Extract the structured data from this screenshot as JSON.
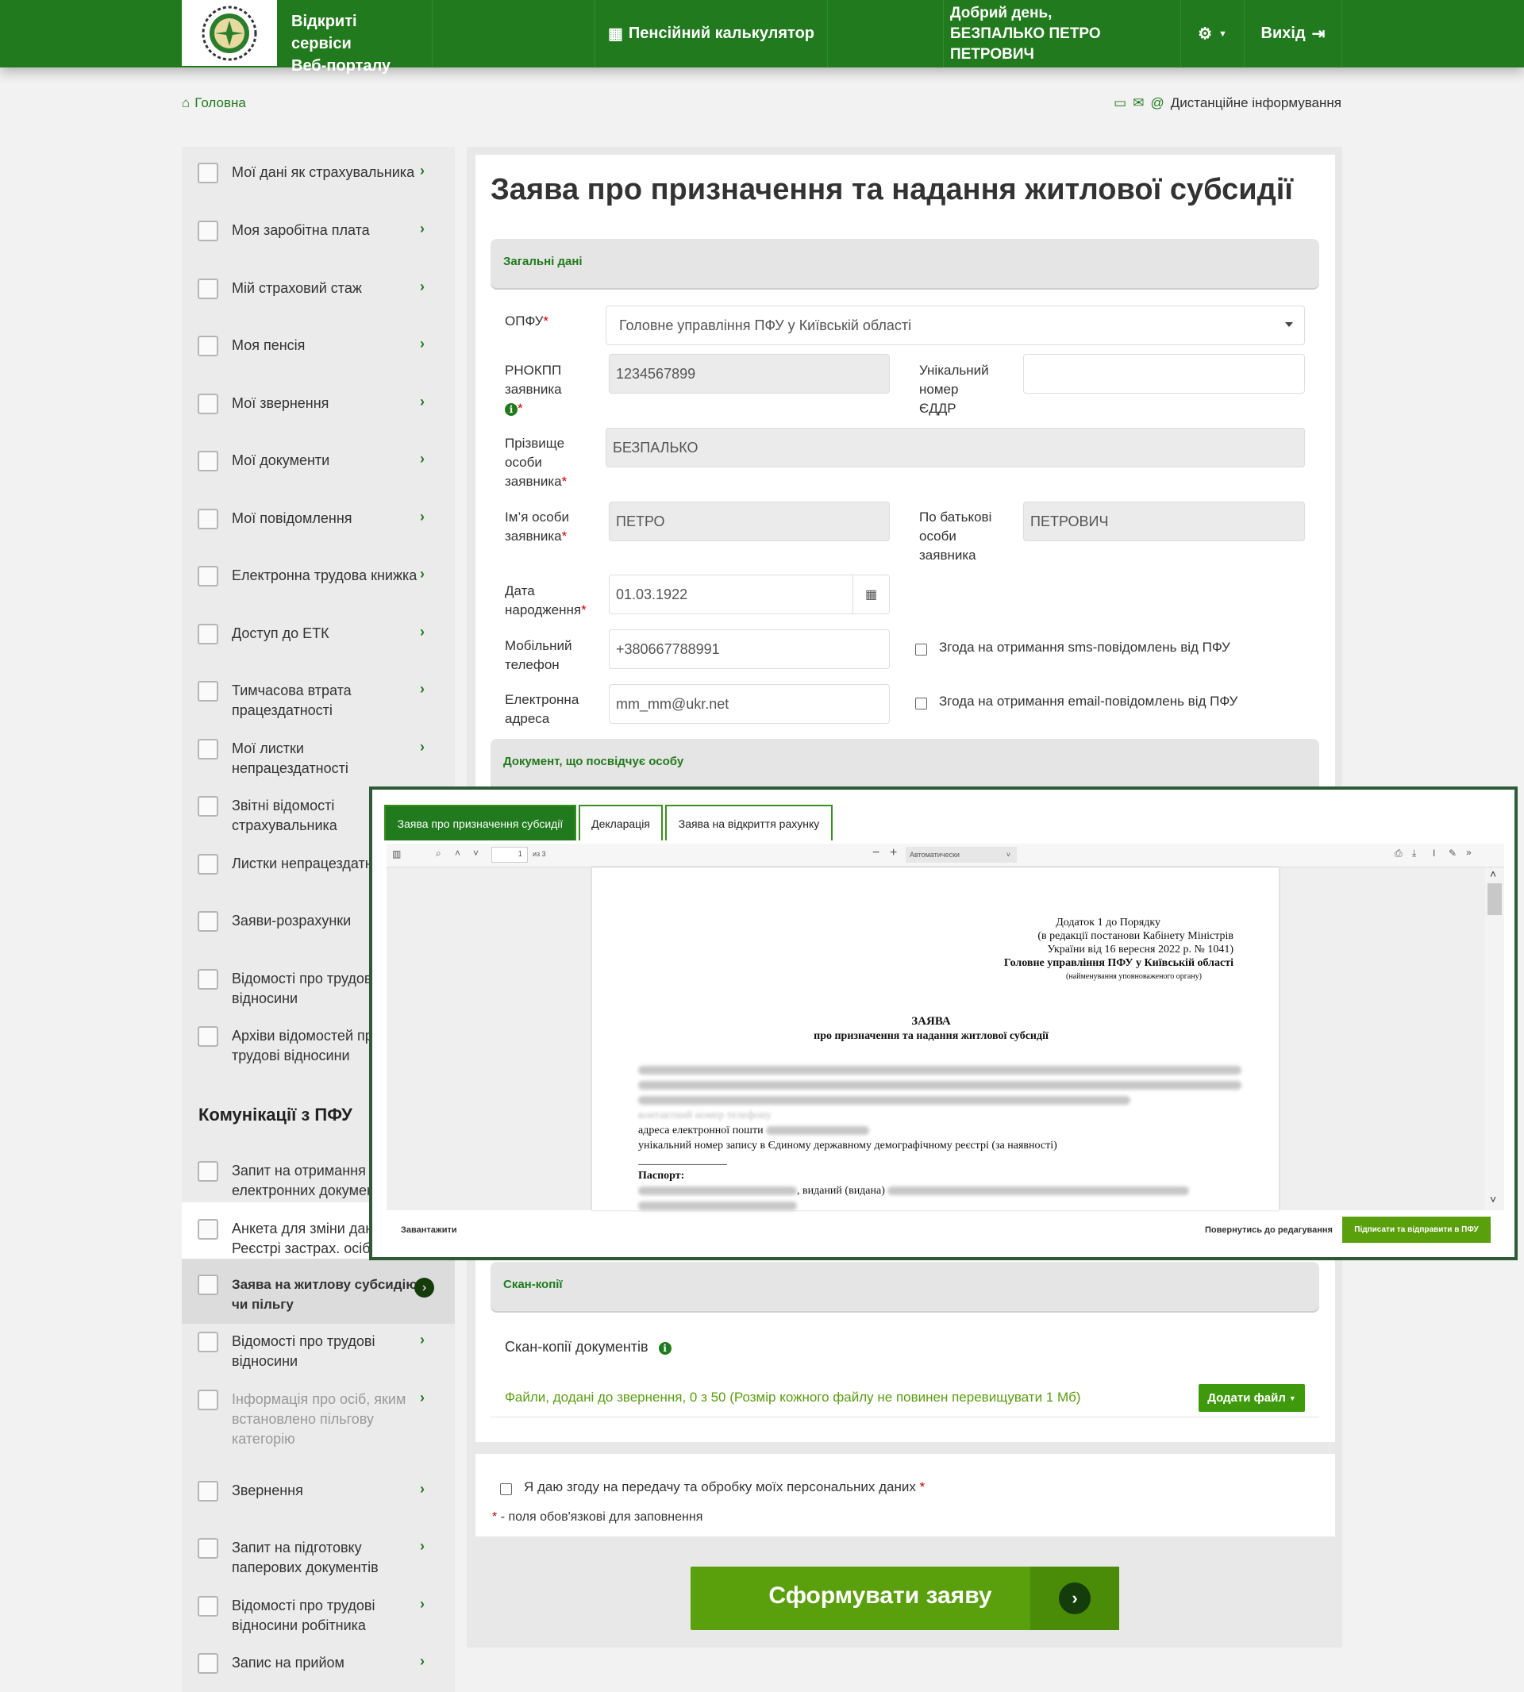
{
  "header": {
    "brand_line1": "Відкриті сервіси",
    "brand_line2": "Веб-порталу",
    "calculator": "Пенсійний калькулятор",
    "greeting_line1": "Добрий день,",
    "greeting_line2": "БЕЗПАЛЬКО ПЕТРО ПЕТРОВИЧ",
    "logout": "Вихід",
    "accent_color": "#217a1d"
  },
  "breadcrumb": {
    "home": "Головна"
  },
  "distance_info": "Дистанційне інформування",
  "sidebar": {
    "items": [
      {
        "label": "Мої дані як страхувальника"
      },
      {
        "label": "Моя заробітна плата"
      },
      {
        "label": "Мій страховий стаж"
      },
      {
        "label": "Моя пенсія"
      },
      {
        "label": "Мої звернення"
      },
      {
        "label": "Мої документи"
      },
      {
        "label": "Мої повідомлення"
      },
      {
        "label": "Електронна трудова книжка"
      },
      {
        "label": "Доступ до ЕТК"
      },
      {
        "label": "Тимчасова втрата працездатності"
      },
      {
        "label": "Мої листки непрацездатності"
      },
      {
        "label": "Звітні відомості страхувальника"
      },
      {
        "label": "Листки непрацездатності"
      },
      {
        "label": "Заяви-розрахунки"
      },
      {
        "label": "Відомості про трудові відносини"
      },
      {
        "label": "Архіви відомостей про трудові відносини"
      }
    ],
    "section_title": "Комунікації з ПФУ",
    "comm_items": [
      {
        "label": "Запит на отримання електронних документів"
      },
      {
        "label": "Анкета для зміни даних в Реєстрі застрах. осіб"
      },
      {
        "label": "Заява на житлову субсидію чи пільгу"
      },
      {
        "label": "Відомості про трудові відносини"
      },
      {
        "label": "Інформація про осіб, яким встановлено пільгову категорію"
      },
      {
        "label": "Звернення"
      },
      {
        "label": "Запит на підготовку паперових документів"
      },
      {
        "label": "Відомості про трудові відносини робітника"
      },
      {
        "label": "Запис на прийом"
      }
    ]
  },
  "form": {
    "title": "Заява про призначення та надання житлової субсидії",
    "section_general": "Загальні дані",
    "opfu_label": "ОПФУ",
    "opfu_value": "Головне управління ПФУ у Київській області",
    "rnokpp_label": "РНОКПП заявника",
    "rnokpp_value": "1234567899",
    "unique_label": "Унікальний номер ЄДДР",
    "unique_value": "",
    "surname_label": "Прізвище особи заявника",
    "surname_value": "БЕЗПАЛЬКО",
    "name_label": "Ім’я особи заявника",
    "name_value": "ПЕТРО",
    "patronymic_label": "По батькові особи заявника",
    "patronymic_value": "ПЕТРОВИЧ",
    "birth_label": "Дата народження",
    "birth_value": "01.03.1922",
    "phone_label": "Мобільний телефон",
    "phone_value": "+380667788991",
    "sms_consent": "Згода на отримання sms-повідомлень від ПФУ",
    "email_label": "Електронна адреса",
    "email_value": "mm_mm@ukr.net",
    "email_consent": "Згода на отримання email-повідомлень від ПФУ",
    "section_document": "Документ, що посвідчує особу",
    "section_scans": "Скан-копії",
    "scans_label": "Скан-копії документів",
    "files_text": "Файли, додані до звернення, 0 з 50 (Розмір кожного файлу не повинен перевищувати 1 Мб)",
    "add_file": "Додати файл",
    "consent": "Я даю згоду на передачу та обробку моїх персональних даних",
    "required_note": "- поля обов'язкові для заповнення",
    "submit": "Сформувати заяву"
  },
  "modal": {
    "tabs": [
      "Заява про призначення субсидії",
      "Декларація",
      "Заява на відкриття рахунку"
    ],
    "page_input": "1",
    "page_of": "из 3",
    "zoom": "Автоматически",
    "doc": {
      "appendix": "Додаток 1 до Порядку",
      "edition": "(в редакції постанови Кабінету Міністрів",
      "edition2": "України від 16 вересня 2022 р. № 1041)",
      "authority": "Головне управління ПФУ у Київській області",
      "authority_note": "(найменування уповноваженого органу)",
      "heading": "ЗАЯВА",
      "subheading": "про призначення та надання житлової субсидії",
      "phone_line": "контактний номер телефону",
      "email_line": "адреса електронної пошти",
      "registry_line": "унікальний номер запису в Єдиному державному демографічному реєстрі (за наявності)",
      "passport": "Паспорт:",
      "series": "Серія (за наявності):",
      "issued": ", виданий (видана)"
    },
    "download": "Завантажити",
    "back": "Повернутись до редагування",
    "sign": "Підписати та відправити в ПФУ"
  }
}
